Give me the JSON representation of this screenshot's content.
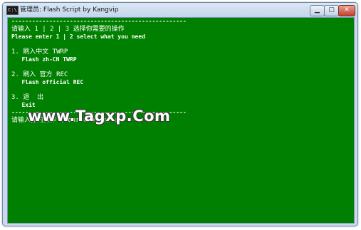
{
  "window": {
    "title": "管理员:  Flash Script by Kangvip",
    "icon_name": "cmd-icon",
    "icon_text": "C:\\",
    "minimize_label": "▁",
    "maximize_label": "▢",
    "close_label": "✕"
  },
  "console": {
    "lines": [
      "---------------------------------------------------",
      "请输入 1 | 2 | 3 选择你需要的操作",
      "Please enter 1 | 2 select what you need",
      "",
      "1. 刷入中文 TWRP",
      "   Flash zh-CN TWRP",
      "",
      "2. 刷入 官方 REC",
      "   Flash official REC",
      "",
      "3. 退  出",
      "   Exit",
      "---------------------------------------------------",
      "请输入你的操作 (Your choice) :"
    ]
  },
  "watermark": "www.Tagxp.Com"
}
